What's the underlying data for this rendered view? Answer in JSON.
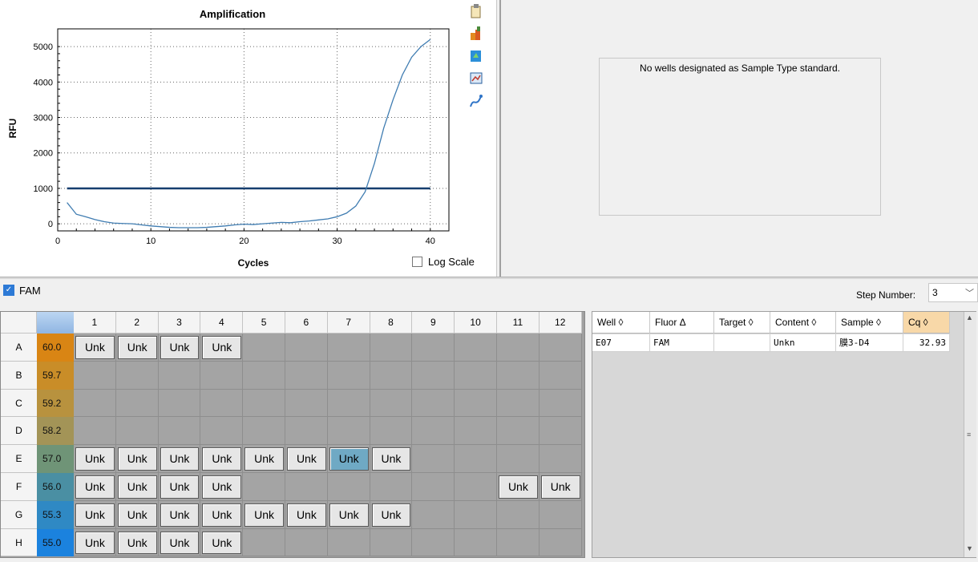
{
  "chart_data": {
    "type": "line",
    "title": "Amplification",
    "xlabel": "Cycles",
    "ylabel": "RFU",
    "xlim": [
      0,
      42
    ],
    "ylim": [
      -200,
      5500
    ],
    "x_ticks": [
      "0",
      "10",
      "20",
      "30",
      "40"
    ],
    "y_ticks": [
      "0",
      "1000",
      "2000",
      "3000",
      "4000",
      "5000"
    ],
    "threshold": 1000,
    "grid": true,
    "series": [
      {
        "x": [
          1,
          2,
          3,
          4,
          5,
          6,
          7,
          8,
          9,
          10,
          11,
          12,
          13,
          14,
          15,
          16,
          17,
          18,
          19,
          20,
          21,
          22,
          23,
          24,
          25,
          26,
          27,
          28,
          29,
          30,
          31,
          32,
          33,
          34,
          35,
          36,
          37,
          38,
          39,
          40
        ],
        "y": [
          600,
          270,
          200,
          120,
          60,
          20,
          10,
          0,
          -30,
          -60,
          -80,
          -100,
          -110,
          -110,
          -110,
          -100,
          -80,
          -60,
          -30,
          -10,
          -20,
          0,
          20,
          40,
          30,
          60,
          80,
          110,
          140,
          200,
          300,
          500,
          900,
          1700,
          2700,
          3500,
          4200,
          4700,
          5000,
          5200
        ]
      }
    ]
  },
  "chart_panel": {
    "log_scale_label": "Log Scale",
    "log_scale_checked": false
  },
  "right_panel": {
    "message": "No wells designated as Sample Type standard."
  },
  "toolbar": {
    "fluor_label": "FAM",
    "fluor_checked": true,
    "step_label": "Step Number:",
    "step_value": "3"
  },
  "plate": {
    "columns": [
      "1",
      "2",
      "3",
      "4",
      "5",
      "6",
      "7",
      "8",
      "9",
      "10",
      "11",
      "12"
    ],
    "rows": [
      {
        "label": "A",
        "temp": "60.0",
        "color": "#d98514",
        "wells": [
          "Unk",
          "Unk",
          "Unk",
          "Unk",
          "",
          "",
          "",
          "",
          "",
          "",
          "",
          ""
        ]
      },
      {
        "label": "B",
        "temp": "59.7",
        "color": "#c98d28",
        "wells": [
          "",
          "",
          "",
          "",
          "",
          "",
          "",
          "",
          "",
          "",
          "",
          ""
        ]
      },
      {
        "label": "C",
        "temp": "59.2",
        "color": "#b8923e",
        "wells": [
          "",
          "",
          "",
          "",
          "",
          "",
          "",
          "",
          "",
          "",
          "",
          ""
        ]
      },
      {
        "label": "D",
        "temp": "58.2",
        "color": "#a39457",
        "wells": [
          "",
          "",
          "",
          "",
          "",
          "",
          "",
          "",
          "",
          "",
          "",
          ""
        ]
      },
      {
        "label": "E",
        "temp": "57.0",
        "color": "#6f9477",
        "wells": [
          "Unk",
          "Unk",
          "Unk",
          "Unk",
          "Unk",
          "Unk",
          "Unk",
          "Unk",
          "",
          "",
          "",
          ""
        ]
      },
      {
        "label": "F",
        "temp": "56.0",
        "color": "#4a8fa3",
        "wells": [
          "Unk",
          "Unk",
          "Unk",
          "Unk",
          "",
          "",
          "",
          "",
          "",
          "",
          "Unk",
          "Unk"
        ]
      },
      {
        "label": "G",
        "temp": "55.3",
        "color": "#2f89c4",
        "wells": [
          "Unk",
          "Unk",
          "Unk",
          "Unk",
          "Unk",
          "Unk",
          "Unk",
          "Unk",
          "",
          "",
          "",
          ""
        ]
      },
      {
        "label": "H",
        "temp": "55.0",
        "color": "#1b82de",
        "wells": [
          "Unk",
          "Unk",
          "Unk",
          "Unk",
          "",
          "",
          "",
          "",
          "",
          "",
          "",
          ""
        ]
      }
    ],
    "selected": "E7"
  },
  "table": {
    "headers": [
      "Well",
      "Fluor",
      "Target",
      "Content",
      "Sample",
      "Cq"
    ],
    "sort_glyphs": [
      "◊",
      "Δ",
      "◊",
      "◊",
      "◊",
      "◊"
    ],
    "rows": [
      [
        "E07",
        "FAM",
        "",
        "Unkn",
        "膜3-D4",
        "32.93"
      ]
    ]
  },
  "colors": {
    "curve": "#3f7cb1",
    "threshold": "#163e6e",
    "cq_header": "#f8d8a8"
  },
  "icons": [
    "copy-icon",
    "export-icon",
    "refresh-icon",
    "chart-settings-icon",
    "curve-icon"
  ]
}
